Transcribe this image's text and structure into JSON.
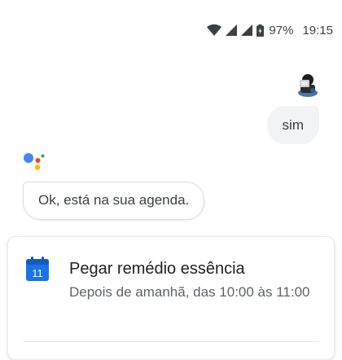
{
  "status_bar": {
    "icons": [
      "wifi-icon",
      "cell-signal-icon",
      "cell-signal-icon",
      "battery-icon"
    ],
    "battery_percent": "97%",
    "time": "19:15"
  },
  "conversation": {
    "user_message": "sim",
    "assistant_message": "Ok, está na sua agenda."
  },
  "event_card": {
    "calendar_day": "11",
    "title": "Pegar remédio essência",
    "subtitle": "Depois de amanhã, das 10:00 às 11:00"
  },
  "colors": {
    "google_blue": "#4285F4",
    "google_red": "#EA4335",
    "google_yellow": "#FBBC05",
    "google_green": "#34A853",
    "bubble_gray": "#f1f3f4",
    "calendar_blue": "#1a73e8"
  }
}
